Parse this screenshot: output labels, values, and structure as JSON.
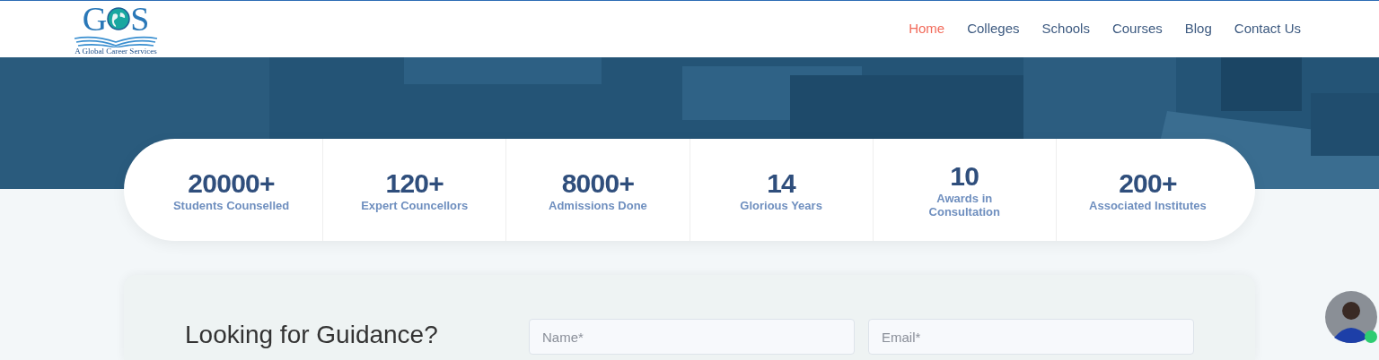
{
  "logo": {
    "letters": [
      "G",
      "S"
    ],
    "tagline": "A Global Career Services"
  },
  "nav": [
    {
      "label": "Home",
      "selected": true
    },
    {
      "label": "Colleges",
      "selected": false
    },
    {
      "label": "Schools",
      "selected": false
    },
    {
      "label": "Courses",
      "selected": false
    },
    {
      "label": "Blog",
      "selected": false
    },
    {
      "label": "Contact Us",
      "selected": false
    }
  ],
  "stats": [
    {
      "value": "20000+",
      "label_lines": [
        "Students Counselled"
      ]
    },
    {
      "value": "120+",
      "label_lines": [
        "Expert Councellors"
      ]
    },
    {
      "value": "8000+",
      "label_lines": [
        "Admissions Done"
      ]
    },
    {
      "value": "14",
      "label_lines": [
        "Glorious Years"
      ]
    },
    {
      "value": "10",
      "label_lines": [
        "Awards in",
        "Consultation"
      ]
    },
    {
      "value": "200+",
      "label_lines": [
        "Associated Institutes"
      ]
    }
  ],
  "enquiry": {
    "heading": "Looking for Guidance?",
    "fields": [
      {
        "placeholder": "Name*"
      },
      {
        "placeholder": "Email*"
      }
    ]
  },
  "chat": {
    "online": true
  }
}
